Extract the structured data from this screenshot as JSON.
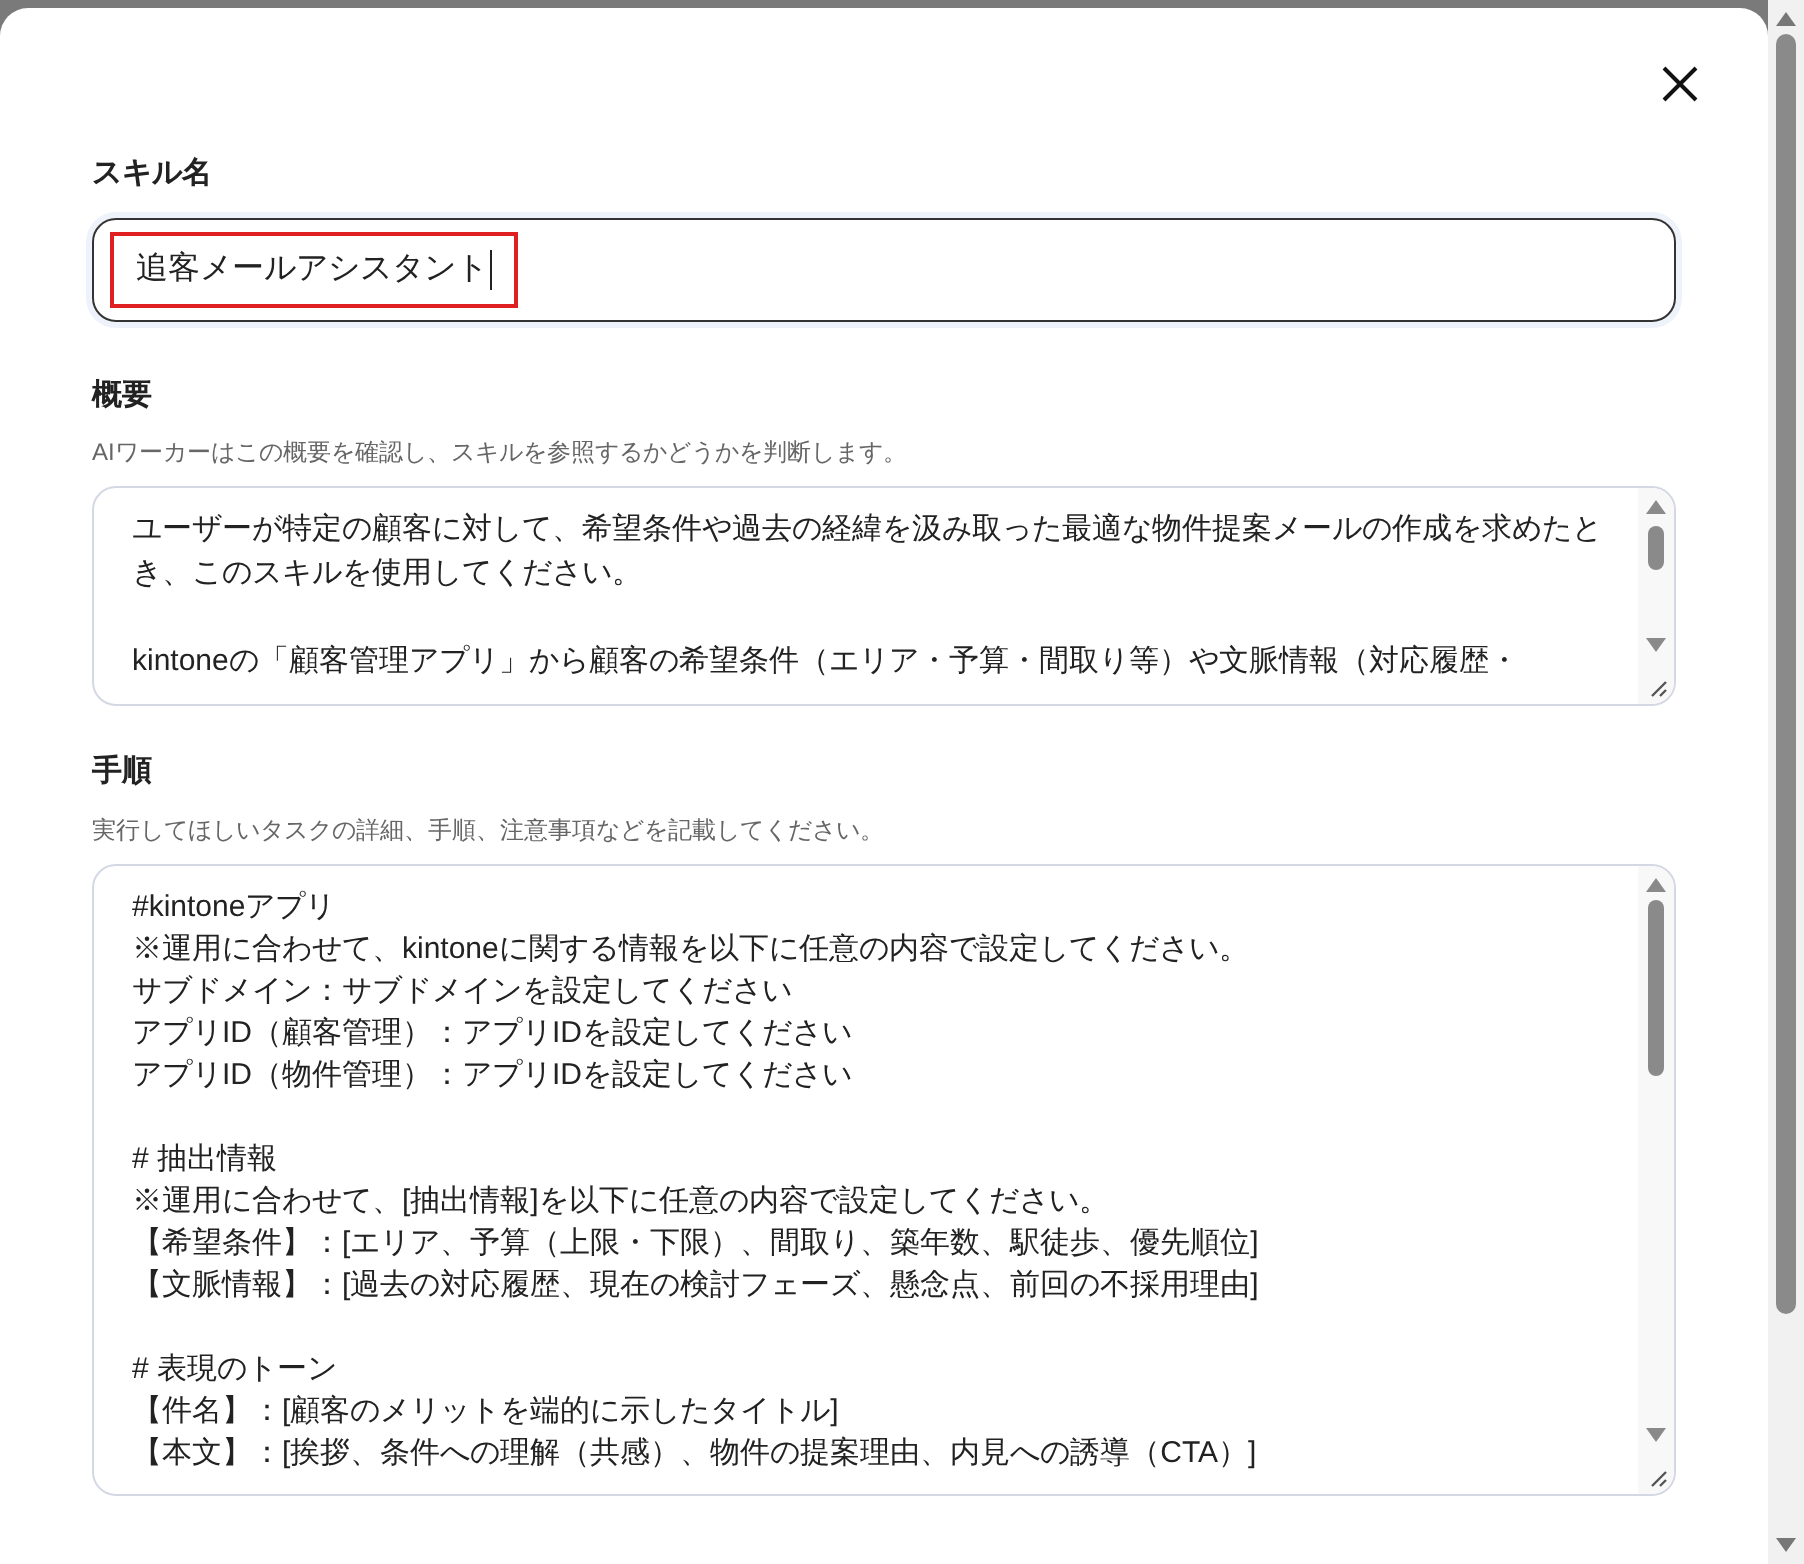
{
  "skill_name": {
    "label": "スキル名",
    "value": "追客メールアシスタント",
    "highlighted": true
  },
  "overview": {
    "label": "概要",
    "hint": "AIワーカーはこの概要を確認し、スキルを参照するかどうかを判断します。",
    "paragraphs": [
      "ユーザーが特定の顧客に対して、希望条件や過去の経緯を汲み取った最適な物件提案メールの作成を求めたとき、このスキルを使用してください。",
      "kintoneの「顧客管理アプリ」から顧客の希望条件（エリア・予算・間取り等）や文脈情報（対応履歴・"
    ]
  },
  "steps": {
    "label": "手順",
    "hint": "実行してほしいタスクの詳細、手順、注意事項などを記載してください。",
    "sections": [
      [
        "#kintoneアプリ",
        "※運用に合わせて、kintoneに関する情報を以下に任意の内容で設定してください。",
        "サブドメイン：サブドメインを設定してください",
        "アプリID（顧客管理）：アプリIDを設定してください",
        "アプリID（物件管理）：アプリIDを設定してください"
      ],
      [
        "# 抽出情報",
        "※運用に合わせて、[抽出情報]を以下に任意の内容で設定してください。",
        "【希望条件】：[エリア、予算（上限・下限）、間取り、築年数、駅徒歩、優先順位]",
        "【文脈情報】：[過去の対応履歴、現在の検討フェーズ、懸念点、前回の不採用理由]"
      ],
      [
        "# 表現のトーン",
        "【件名】：[顧客のメリットを端的に示したタイトル]",
        "【本文】：[挨拶、条件への理解（共感）、物件の提案理由、内見への誘導（CTA）]"
      ]
    ]
  }
}
